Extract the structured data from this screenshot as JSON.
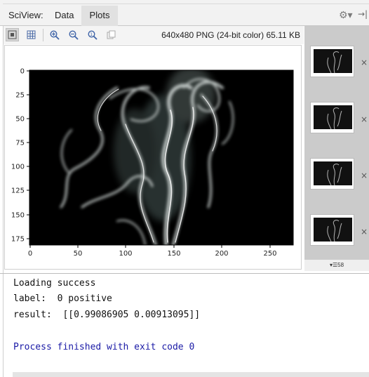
{
  "sciview": {
    "label": "SciView:",
    "tabs": [
      "Data",
      "Plots"
    ],
    "active_tab": "Plots"
  },
  "toolbar": {
    "image_info": "640x480 PNG (24-bit color) 65.11 KB",
    "buttons": [
      "fit-to-window-icon",
      "grid-icon",
      "zoom-in-icon",
      "zoom-out-icon",
      "actual-size-icon",
      "copy-icon"
    ]
  },
  "plot": {
    "x_ticks": [
      "0",
      "50",
      "100",
      "150",
      "200",
      "250"
    ],
    "y_ticks": [
      "0",
      "25",
      "50",
      "75",
      "100",
      "125",
      "150",
      "175"
    ],
    "image_background": "#000000"
  },
  "thumbnails": {
    "count": 4,
    "close_glyph": "×",
    "footer_label": "▾☰58"
  },
  "console": {
    "lines": [
      "Loading success",
      "label:  0 positive",
      "result:  [[0.99086905 0.00913095]]",
      "",
      "Process finished with exit code 0"
    ],
    "exit_color": "#1a1aa6"
  }
}
